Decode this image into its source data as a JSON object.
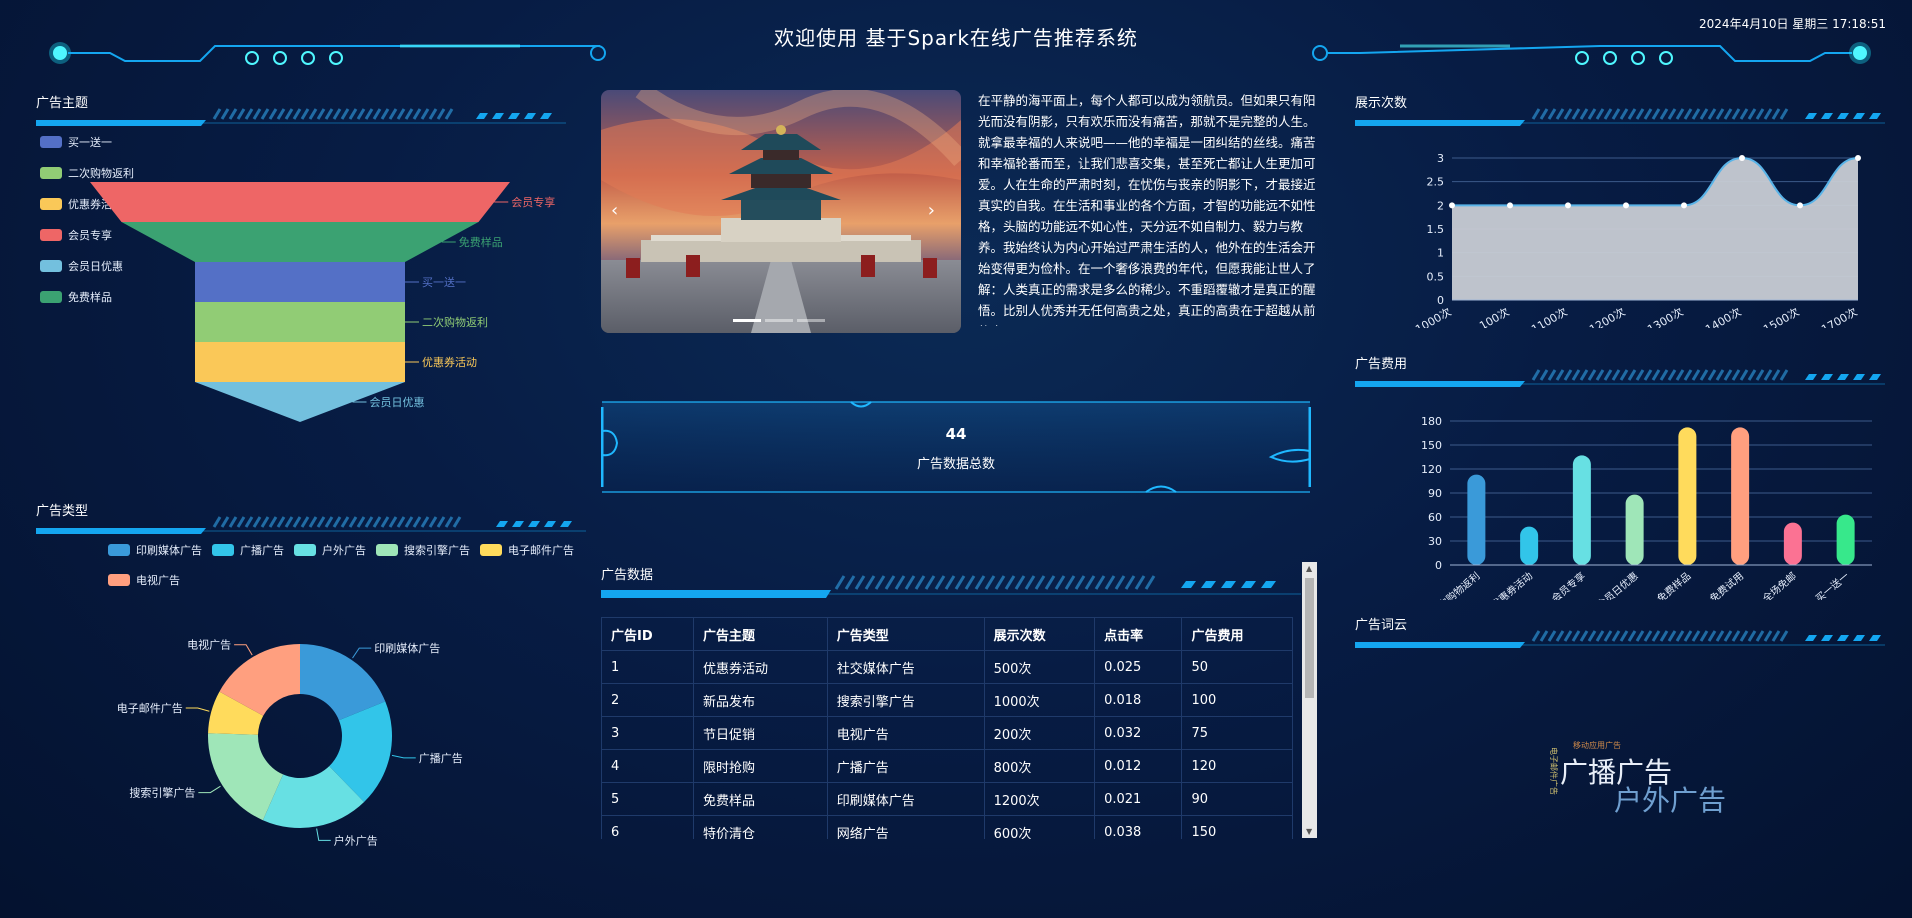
{
  "header": {
    "title": "欢迎使用 基于Spark在线广告推荐系统",
    "datetime": "2024年4月10日 星期三 17:18:51"
  },
  "panels": {
    "topic": {
      "title": "广告主题"
    },
    "type": {
      "title": "广告类型"
    },
    "impressions": {
      "title": "展示次数"
    },
    "cost": {
      "title": "广告费用"
    },
    "wordcloud": {
      "title": "广告词云"
    },
    "data": {
      "title": "广告数据"
    }
  },
  "article": {
    "text": "在平静的海平面上，每个人都可以成为领航员。但如果只有阳光而没有阴影，只有欢乐而没有痛苦，那就不是完整的人生。就拿最幸福的人来说吧——他的幸福是一团纠结的丝线。痛苦和幸福轮番而至，让我们悲喜交集，甚至死亡都让人生更加可爱。人在生命的严肃时刻，在忧伤与丧亲的阴影下，才最接近真实的自我。在生活和事业的各个方面，才智的功能远不如性格，头脑的功能远不如心性，天分远不如自制力、毅力与教养。我始终认为内心开始过严肃生活的人，他外在的生活会开始变得更为俭朴。在一个奢侈浪费的年代，但愿我能让世人了解：人类真正的需求是多么的稀少。不重蹈覆辙才是真正的醒悟。比别人优秀并无任何高贵之处，真正的高贵在于超越从前的自己。"
  },
  "carousel": {
    "prev_glyph": "‹",
    "next_glyph": "›",
    "active_index": 0,
    "count": 3
  },
  "stat": {
    "value": "44",
    "label": "广告数据总数"
  },
  "colors": {
    "accent": "#14a6f0",
    "買一送一": "#5470c6",
    "二次购物返利": "#91cc75",
    "优惠券活动": "#fac858",
    "会员专享": "#ee6666",
    "会员日优惠": "#73c0de",
    "免费样品": "#3ba272"
  },
  "funnel": {
    "legend": [
      {
        "name": "买一送一",
        "color": "#5470c6"
      },
      {
        "name": "二次购物返利",
        "color": "#91cc75"
      },
      {
        "name": "优惠券活动",
        "color": "#fac858"
      },
      {
        "name": "会员专享",
        "color": "#ee6666"
      },
      {
        "name": "会员日优惠",
        "color": "#73c0de"
      },
      {
        "name": "免费样品",
        "color": "#3ba272"
      }
    ]
  },
  "donut": {
    "legend": [
      {
        "name": "印刷媒体广告",
        "color": "#3a9ad9"
      },
      {
        "name": "广播广告",
        "color": "#32c5e9"
      },
      {
        "name": "户外广告",
        "color": "#67e0e3"
      },
      {
        "name": "搜索引擎广告",
        "color": "#9fe6b8"
      },
      {
        "name": "电子邮件广告",
        "color": "#ffdb5c"
      },
      {
        "name": "电视广告",
        "color": "#ff9f7f"
      }
    ]
  },
  "table": {
    "headers": [
      "广告ID",
      "广告主题",
      "广告类型",
      "展示次数",
      "点击率",
      "广告费用"
    ],
    "rows": [
      [
        "1",
        "优惠券活动",
        "社交媒体广告",
        "500次",
        "0.025",
        "50"
      ],
      [
        "2",
        "新品发布",
        "搜索引擎广告",
        "1000次",
        "0.018",
        "100"
      ],
      [
        "3",
        "节日促销",
        "电视广告",
        "200次",
        "0.032",
        "75"
      ],
      [
        "4",
        "限时抢购",
        "广播广告",
        "800次",
        "0.012",
        "120"
      ],
      [
        "5",
        "免费样品",
        "印刷媒体广告",
        "1200次",
        "0.021",
        "90"
      ],
      [
        "6",
        "特价清仓",
        "网络广告",
        "600次",
        "0.038",
        "150"
      ]
    ]
  },
  "wordcloud": {
    "words": [
      {
        "text": "广播广告",
        "color": "#e8eef8"
      },
      {
        "text": "户外广告",
        "color": "#6f9fd0"
      },
      {
        "text": "移动应用广告",
        "color": "#d08a4a"
      },
      {
        "text": "电子邮件广告",
        "color": "#d0c070"
      }
    ]
  },
  "chart_data": [
    {
      "type": "funnel",
      "categories": [
        "会员专享",
        "免费样品",
        "买一送一",
        "二次购物返利",
        "优惠券活动",
        "会员日优惠"
      ],
      "values": [
        100,
        85,
        50,
        50,
        50,
        50
      ],
      "colors": [
        "#ee6666",
        "#3ba272",
        "#5470c6",
        "#91cc75",
        "#fac858",
        "#73c0de"
      ]
    },
    {
      "type": "pie",
      "variant": "donut",
      "categories": [
        "印刷媒体广告",
        "广播广告",
        "户外广告",
        "搜索引擎广告",
        "电子邮件广告",
        "电视广告"
      ],
      "values": [
        20,
        20,
        20,
        20,
        8,
        18
      ],
      "colors": [
        "#3a9ad9",
        "#32c5e9",
        "#67e0e3",
        "#9fe6b8",
        "#ffdb5c",
        "#ff9f7f"
      ]
    },
    {
      "type": "area",
      "categories": [
        "1000次",
        "100次",
        "1100次",
        "1200次",
        "1300次",
        "1400次",
        "1500次",
        "1700次"
      ],
      "values": [
        2,
        2,
        2,
        2,
        2,
        3,
        2,
        3
      ],
      "ylim": [
        0,
        3
      ],
      "yticks": [
        0,
        0.5,
        1,
        1.5,
        2,
        2.5,
        3
      ],
      "fill": "#c8ccd4",
      "line": "#5ab4e8",
      "grid": true
    },
    {
      "type": "bar",
      "categories": [
        "二次购物返利",
        "优惠券活动",
        "会员专享",
        "会员日优惠",
        "免费样品",
        "免费试用",
        "全场免邮",
        "买一送一"
      ],
      "values": [
        113,
        48,
        137,
        88,
        172,
        172,
        53,
        63
      ],
      "colors": [
        "#3a9ad9",
        "#32c5e9",
        "#67e0e3",
        "#9fe6b8",
        "#ffdb5c",
        "#ff9f7f",
        "#fb7293",
        "#37e88b"
      ],
      "ylim": [
        0,
        180
      ],
      "yticks": [
        0,
        30,
        60,
        90,
        120,
        150,
        180
      ],
      "grid": true
    }
  ]
}
